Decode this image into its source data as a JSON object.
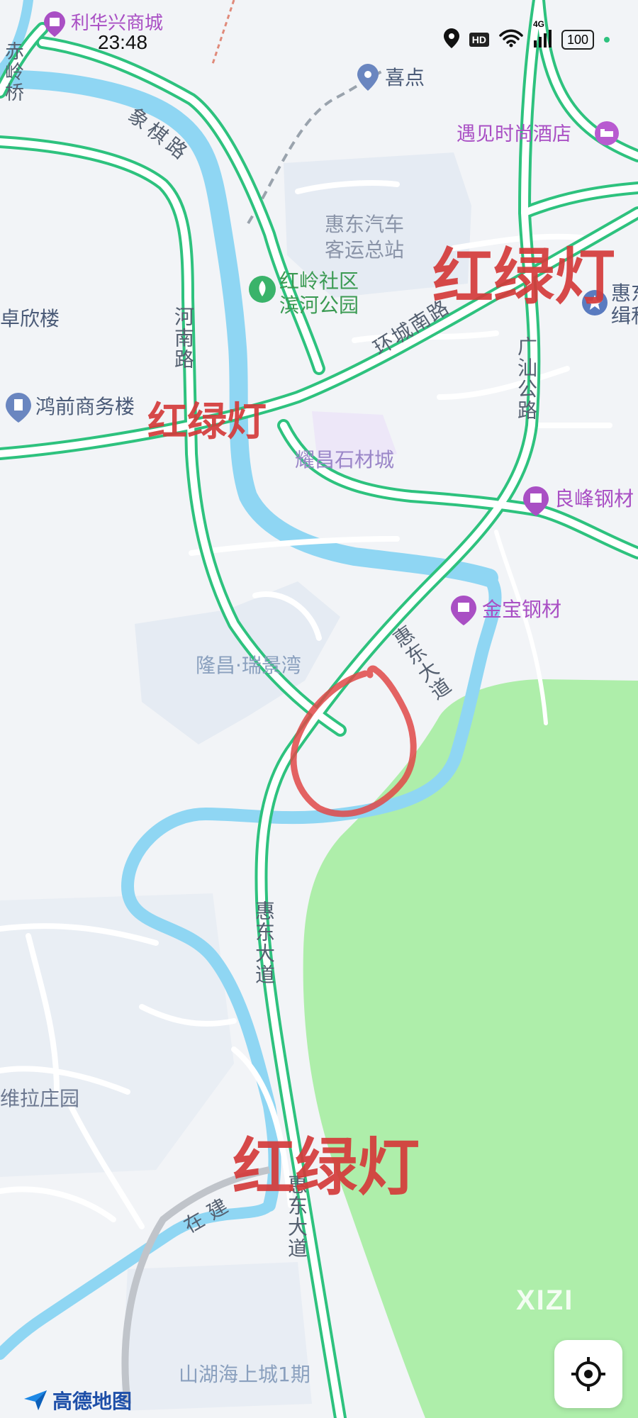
{
  "status_bar": {
    "time": "23:48",
    "icons": [
      "location-icon",
      "hd-icon",
      "wifi-icon",
      "cellular-4g-icon",
      "battery-icon"
    ],
    "network": "4G",
    "battery": "100"
  },
  "map": {
    "poi": {
      "lihuaxing": "利华兴商城",
      "xidian": "喜点",
      "hotel": "遇见时尚酒店",
      "bus_station_line1": "惠东汽车",
      "bus_station_line2": "客运总站",
      "park_line1": "红岭社区",
      "park_line2": "滨河公园",
      "zhuoxin": "卓欣楼",
      "hongqian": "鸿前商务楼",
      "yaochang": "耀昌石材城",
      "liangfeng": "良峰钢材",
      "jinbao": "金宝钢材",
      "longchang": "隆昌·瑞景湾",
      "weila": "维拉庄园",
      "shanhuhai": "山湖海上城1期",
      "huidong_edge_line1": "惠东",
      "huidong_edge_line2": "缉私"
    },
    "roads": {
      "chiling": "赤岭桥",
      "xiangqi": "象棋路",
      "henan": "河南路",
      "huancheng": "环城南路",
      "guangshan": "广汕公路",
      "huidong_1": "惠东大道",
      "huidong_2": "惠东大道",
      "huidong_3": "惠东大道",
      "zaijian": "在建"
    },
    "annotations": {
      "light1": "红绿灯",
      "light2": "红绿灯",
      "light3": "红绿灯"
    },
    "watermark": "XIZI"
  },
  "footer": {
    "logo_text": "高德地图"
  },
  "colors": {
    "background": "#f2f4f7",
    "river": "#8fd6f3",
    "road_green": "#2ec27e",
    "park_green": "#aeeeaa",
    "annotation_red": "#d43a3a",
    "poi_purple": "#a94fc4"
  }
}
